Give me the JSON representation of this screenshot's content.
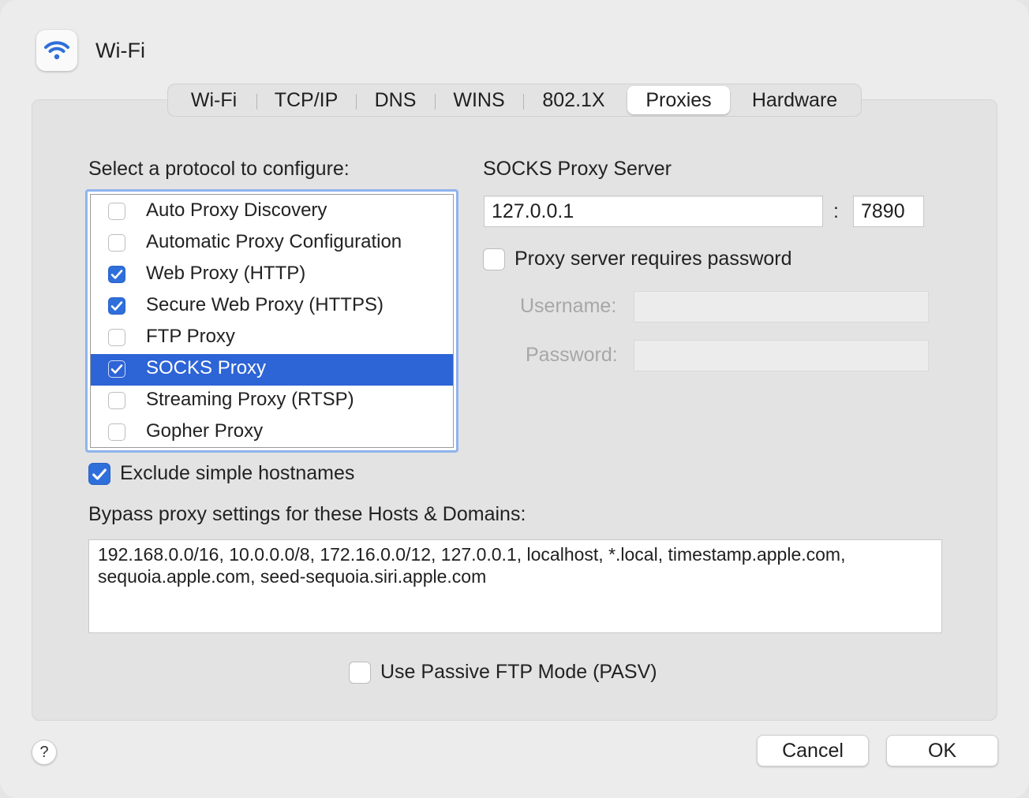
{
  "window": {
    "title": "Wi-Fi",
    "accent_color": "#2f6fdb",
    "selection_color": "#2d64d6"
  },
  "tabs": [
    {
      "label": "Wi-Fi",
      "active": false
    },
    {
      "label": "TCP/IP",
      "active": false
    },
    {
      "label": "DNS",
      "active": false
    },
    {
      "label": "WINS",
      "active": false
    },
    {
      "label": "802.1X",
      "active": false
    },
    {
      "label": "Proxies",
      "active": true
    },
    {
      "label": "Hardware",
      "active": false
    }
  ],
  "protocols": {
    "heading": "Select a protocol to configure:",
    "items": [
      {
        "label": "Auto Proxy Discovery",
        "checked": false,
        "selected": false
      },
      {
        "label": "Automatic Proxy Configuration",
        "checked": false,
        "selected": false
      },
      {
        "label": "Web Proxy (HTTP)",
        "checked": true,
        "selected": false
      },
      {
        "label": "Secure Web Proxy (HTTPS)",
        "checked": true,
        "selected": false
      },
      {
        "label": "FTP Proxy",
        "checked": false,
        "selected": false
      },
      {
        "label": "SOCKS Proxy",
        "checked": true,
        "selected": true
      },
      {
        "label": "Streaming Proxy (RTSP)",
        "checked": false,
        "selected": false
      },
      {
        "label": "Gopher Proxy",
        "checked": false,
        "selected": false
      }
    ]
  },
  "server": {
    "heading": "SOCKS Proxy Server",
    "host": "127.0.0.1",
    "separator": ":",
    "port": "7890",
    "requires_password_label": "Proxy server requires password",
    "requires_password": false,
    "username_label": "Username:",
    "username": "",
    "password_label": "Password:",
    "password": ""
  },
  "exclude_simple": {
    "label": "Exclude simple hostnames",
    "checked": true
  },
  "bypass": {
    "label": "Bypass proxy settings for these Hosts & Domains:",
    "value": "192.168.0.0/16, 10.0.0.0/8, 172.16.0.0/12, 127.0.0.1, localhost, *.local, timestamp.apple.com, sequoia.apple.com, seed-sequoia.siri.apple.com"
  },
  "passive_ftp": {
    "label": "Use Passive FTP Mode (PASV)",
    "checked": false
  },
  "buttons": {
    "help": "?",
    "cancel": "Cancel",
    "ok": "OK"
  }
}
